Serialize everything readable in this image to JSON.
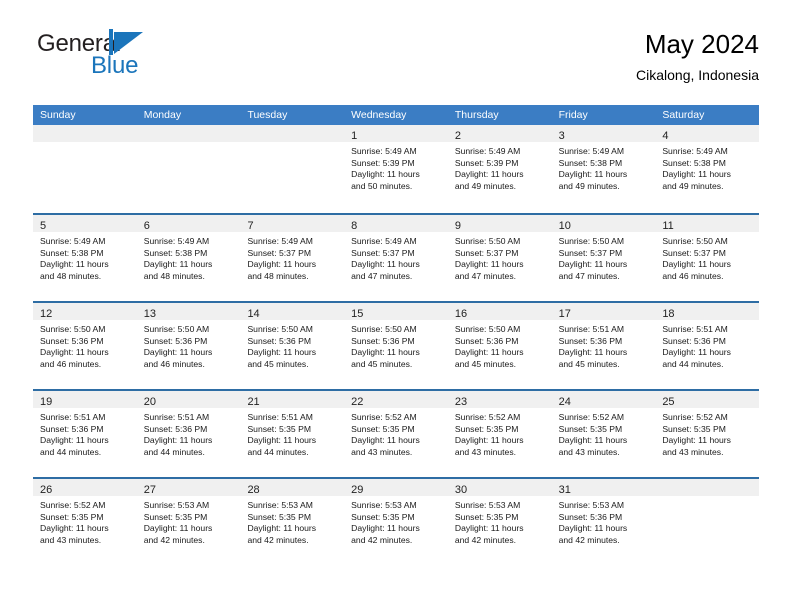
{
  "brand": {
    "name_part1": "General",
    "name_part2": "Blue",
    "logo_icon": "triangle-flag-icon",
    "accent_color": "#1b75bb"
  },
  "header": {
    "title": "May 2024",
    "subtitle": "Cikalong, Indonesia"
  },
  "theme": {
    "header_bar_color": "#3b7dc4",
    "row_border_color": "#2e6da4",
    "date_band_color": "#f0f0f0"
  },
  "weekdays": [
    "Sunday",
    "Monday",
    "Tuesday",
    "Wednesday",
    "Thursday",
    "Friday",
    "Saturday"
  ],
  "weeks": [
    {
      "days": [
        {
          "number": "",
          "sunrise": "",
          "sunset": "",
          "daylight_line1": "",
          "daylight_line2": "",
          "empty": true
        },
        {
          "number": "",
          "sunrise": "",
          "sunset": "",
          "daylight_line1": "",
          "daylight_line2": "",
          "empty": true
        },
        {
          "number": "",
          "sunrise": "",
          "sunset": "",
          "daylight_line1": "",
          "daylight_line2": "",
          "empty": true
        },
        {
          "number": "1",
          "sunrise": "Sunrise: 5:49 AM",
          "sunset": "Sunset: 5:39 PM",
          "daylight_line1": "Daylight: 11 hours",
          "daylight_line2": "and 50 minutes.",
          "empty": false
        },
        {
          "number": "2",
          "sunrise": "Sunrise: 5:49 AM",
          "sunset": "Sunset: 5:39 PM",
          "daylight_line1": "Daylight: 11 hours",
          "daylight_line2": "and 49 minutes.",
          "empty": false
        },
        {
          "number": "3",
          "sunrise": "Sunrise: 5:49 AM",
          "sunset": "Sunset: 5:38 PM",
          "daylight_line1": "Daylight: 11 hours",
          "daylight_line2": "and 49 minutes.",
          "empty": false
        },
        {
          "number": "4",
          "sunrise": "Sunrise: 5:49 AM",
          "sunset": "Sunset: 5:38 PM",
          "daylight_line1": "Daylight: 11 hours",
          "daylight_line2": "and 49 minutes.",
          "empty": false
        }
      ]
    },
    {
      "days": [
        {
          "number": "5",
          "sunrise": "Sunrise: 5:49 AM",
          "sunset": "Sunset: 5:38 PM",
          "daylight_line1": "Daylight: 11 hours",
          "daylight_line2": "and 48 minutes.",
          "empty": false
        },
        {
          "number": "6",
          "sunrise": "Sunrise: 5:49 AM",
          "sunset": "Sunset: 5:38 PM",
          "daylight_line1": "Daylight: 11 hours",
          "daylight_line2": "and 48 minutes.",
          "empty": false
        },
        {
          "number": "7",
          "sunrise": "Sunrise: 5:49 AM",
          "sunset": "Sunset: 5:37 PM",
          "daylight_line1": "Daylight: 11 hours",
          "daylight_line2": "and 48 minutes.",
          "empty": false
        },
        {
          "number": "8",
          "sunrise": "Sunrise: 5:49 AM",
          "sunset": "Sunset: 5:37 PM",
          "daylight_line1": "Daylight: 11 hours",
          "daylight_line2": "and 47 minutes.",
          "empty": false
        },
        {
          "number": "9",
          "sunrise": "Sunrise: 5:50 AM",
          "sunset": "Sunset: 5:37 PM",
          "daylight_line1": "Daylight: 11 hours",
          "daylight_line2": "and 47 minutes.",
          "empty": false
        },
        {
          "number": "10",
          "sunrise": "Sunrise: 5:50 AM",
          "sunset": "Sunset: 5:37 PM",
          "daylight_line1": "Daylight: 11 hours",
          "daylight_line2": "and 47 minutes.",
          "empty": false
        },
        {
          "number": "11",
          "sunrise": "Sunrise: 5:50 AM",
          "sunset": "Sunset: 5:37 PM",
          "daylight_line1": "Daylight: 11 hours",
          "daylight_line2": "and 46 minutes.",
          "empty": false
        }
      ]
    },
    {
      "days": [
        {
          "number": "12",
          "sunrise": "Sunrise: 5:50 AM",
          "sunset": "Sunset: 5:36 PM",
          "daylight_line1": "Daylight: 11 hours",
          "daylight_line2": "and 46 minutes.",
          "empty": false
        },
        {
          "number": "13",
          "sunrise": "Sunrise: 5:50 AM",
          "sunset": "Sunset: 5:36 PM",
          "daylight_line1": "Daylight: 11 hours",
          "daylight_line2": "and 46 minutes.",
          "empty": false
        },
        {
          "number": "14",
          "sunrise": "Sunrise: 5:50 AM",
          "sunset": "Sunset: 5:36 PM",
          "daylight_line1": "Daylight: 11 hours",
          "daylight_line2": "and 45 minutes.",
          "empty": false
        },
        {
          "number": "15",
          "sunrise": "Sunrise: 5:50 AM",
          "sunset": "Sunset: 5:36 PM",
          "daylight_line1": "Daylight: 11 hours",
          "daylight_line2": "and 45 minutes.",
          "empty": false
        },
        {
          "number": "16",
          "sunrise": "Sunrise: 5:50 AM",
          "sunset": "Sunset: 5:36 PM",
          "daylight_line1": "Daylight: 11 hours",
          "daylight_line2": "and 45 minutes.",
          "empty": false
        },
        {
          "number": "17",
          "sunrise": "Sunrise: 5:51 AM",
          "sunset": "Sunset: 5:36 PM",
          "daylight_line1": "Daylight: 11 hours",
          "daylight_line2": "and 45 minutes.",
          "empty": false
        },
        {
          "number": "18",
          "sunrise": "Sunrise: 5:51 AM",
          "sunset": "Sunset: 5:36 PM",
          "daylight_line1": "Daylight: 11 hours",
          "daylight_line2": "and 44 minutes.",
          "empty": false
        }
      ]
    },
    {
      "days": [
        {
          "number": "19",
          "sunrise": "Sunrise: 5:51 AM",
          "sunset": "Sunset: 5:36 PM",
          "daylight_line1": "Daylight: 11 hours",
          "daylight_line2": "and 44 minutes.",
          "empty": false
        },
        {
          "number": "20",
          "sunrise": "Sunrise: 5:51 AM",
          "sunset": "Sunset: 5:36 PM",
          "daylight_line1": "Daylight: 11 hours",
          "daylight_line2": "and 44 minutes.",
          "empty": false
        },
        {
          "number": "21",
          "sunrise": "Sunrise: 5:51 AM",
          "sunset": "Sunset: 5:35 PM",
          "daylight_line1": "Daylight: 11 hours",
          "daylight_line2": "and 44 minutes.",
          "empty": false
        },
        {
          "number": "22",
          "sunrise": "Sunrise: 5:52 AM",
          "sunset": "Sunset: 5:35 PM",
          "daylight_line1": "Daylight: 11 hours",
          "daylight_line2": "and 43 minutes.",
          "empty": false
        },
        {
          "number": "23",
          "sunrise": "Sunrise: 5:52 AM",
          "sunset": "Sunset: 5:35 PM",
          "daylight_line1": "Daylight: 11 hours",
          "daylight_line2": "and 43 minutes.",
          "empty": false
        },
        {
          "number": "24",
          "sunrise": "Sunrise: 5:52 AM",
          "sunset": "Sunset: 5:35 PM",
          "daylight_line1": "Daylight: 11 hours",
          "daylight_line2": "and 43 minutes.",
          "empty": false
        },
        {
          "number": "25",
          "sunrise": "Sunrise: 5:52 AM",
          "sunset": "Sunset: 5:35 PM",
          "daylight_line1": "Daylight: 11 hours",
          "daylight_line2": "and 43 minutes.",
          "empty": false
        }
      ]
    },
    {
      "days": [
        {
          "number": "26",
          "sunrise": "Sunrise: 5:52 AM",
          "sunset": "Sunset: 5:35 PM",
          "daylight_line1": "Daylight: 11 hours",
          "daylight_line2": "and 43 minutes.",
          "empty": false
        },
        {
          "number": "27",
          "sunrise": "Sunrise: 5:53 AM",
          "sunset": "Sunset: 5:35 PM",
          "daylight_line1": "Daylight: 11 hours",
          "daylight_line2": "and 42 minutes.",
          "empty": false
        },
        {
          "number": "28",
          "sunrise": "Sunrise: 5:53 AM",
          "sunset": "Sunset: 5:35 PM",
          "daylight_line1": "Daylight: 11 hours",
          "daylight_line2": "and 42 minutes.",
          "empty": false
        },
        {
          "number": "29",
          "sunrise": "Sunrise: 5:53 AM",
          "sunset": "Sunset: 5:35 PM",
          "daylight_line1": "Daylight: 11 hours",
          "daylight_line2": "and 42 minutes.",
          "empty": false
        },
        {
          "number": "30",
          "sunrise": "Sunrise: 5:53 AM",
          "sunset": "Sunset: 5:35 PM",
          "daylight_line1": "Daylight: 11 hours",
          "daylight_line2": "and 42 minutes.",
          "empty": false
        },
        {
          "number": "31",
          "sunrise": "Sunrise: 5:53 AM",
          "sunset": "Sunset: 5:36 PM",
          "daylight_line1": "Daylight: 11 hours",
          "daylight_line2": "and 42 minutes.",
          "empty": false
        },
        {
          "number": "",
          "sunrise": "",
          "sunset": "",
          "daylight_line1": "",
          "daylight_line2": "",
          "empty": true
        }
      ]
    }
  ]
}
